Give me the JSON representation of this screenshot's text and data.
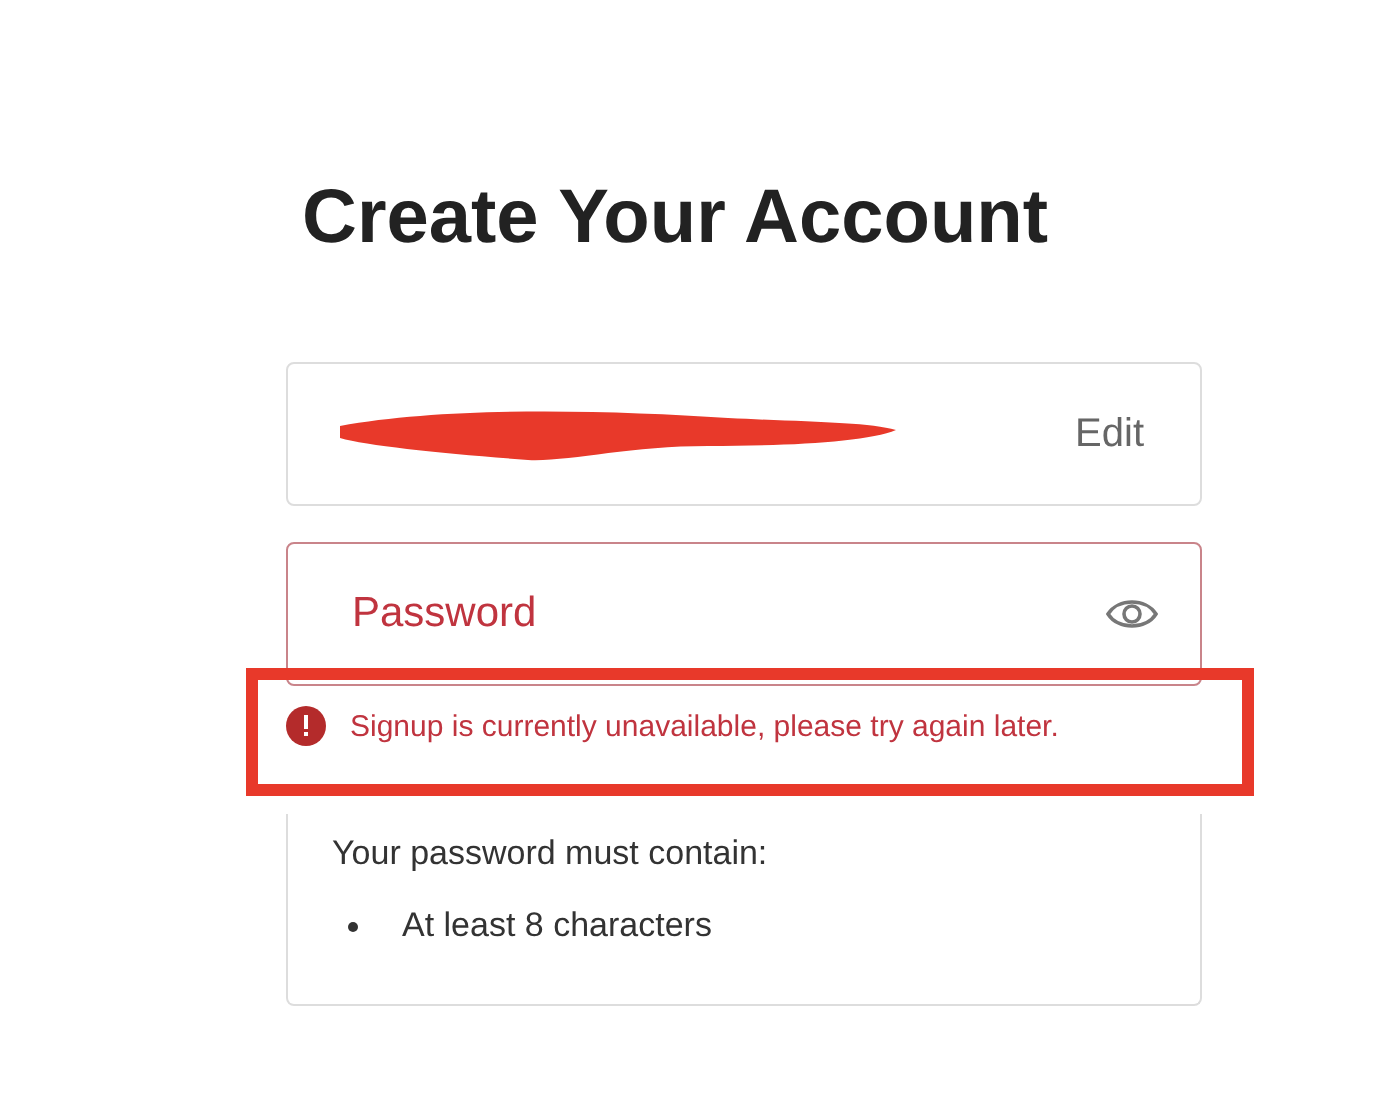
{
  "title": "Create Your Account",
  "email_field": {
    "redacted": true,
    "action": "Edit"
  },
  "password_field": {
    "placeholder": "Password",
    "invalid": true
  },
  "error_message": "Signup is currently unavailable, please try again later.",
  "annotation": {
    "kind": "highlight-box"
  },
  "requirements": {
    "heading": "Your password must contain:",
    "items": [
      "At least 8 characters"
    ]
  }
}
